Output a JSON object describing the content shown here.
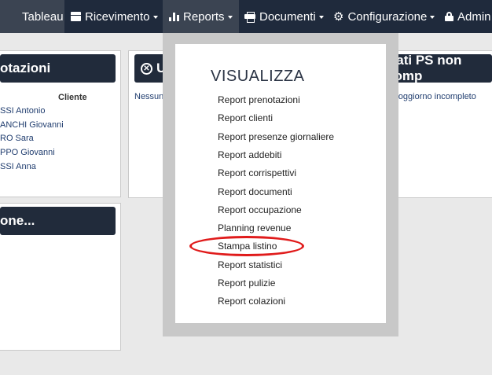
{
  "navbar": {
    "items": [
      {
        "label": "Tableau",
        "icon": "table-icon"
      },
      {
        "label": "Ricevimento",
        "icon": "briefcase-icon"
      },
      {
        "label": "Reports",
        "icon": "bar-chart-icon"
      },
      {
        "label": "Documenti",
        "icon": "printer-icon"
      },
      {
        "label": "Configurazione",
        "icon": "gear-icon"
      },
      {
        "label": "Admin",
        "icon": "lock-icon"
      }
    ]
  },
  "panels": {
    "prenotazioni": {
      "title": "otazioni",
      "column_header": "Cliente",
      "rows": [
        "SSI Antonio",
        "ANCHI Giovanni",
        "RO Sara",
        "PPO Giovanni",
        "SSI Anna"
      ]
    },
    "ultimi": {
      "title": "Ult",
      "text": "Nessuna c"
    },
    "dati_ps": {
      "title": "Dati PS non comp",
      "text": "un soggiorno incompleto"
    },
    "lower": {
      "title": "one..."
    }
  },
  "dropdown": {
    "section_title": "VISUALIZZA",
    "items": [
      "Report prenotazioni",
      "Report clienti",
      "Report presenze giornaliere",
      "Report addebiti",
      "Report corrispettivi",
      "Report documenti",
      "Report occupazione",
      "Planning revenue",
      "Stampa listino",
      "Report statistici",
      "Report pulizie",
      "Report colazioni"
    ],
    "highlighted_item": "Stampa listino"
  },
  "colors": {
    "navbar": "#1f2a3c",
    "panel_header": "#212b3b",
    "highlight_ring": "#e01b1b"
  }
}
